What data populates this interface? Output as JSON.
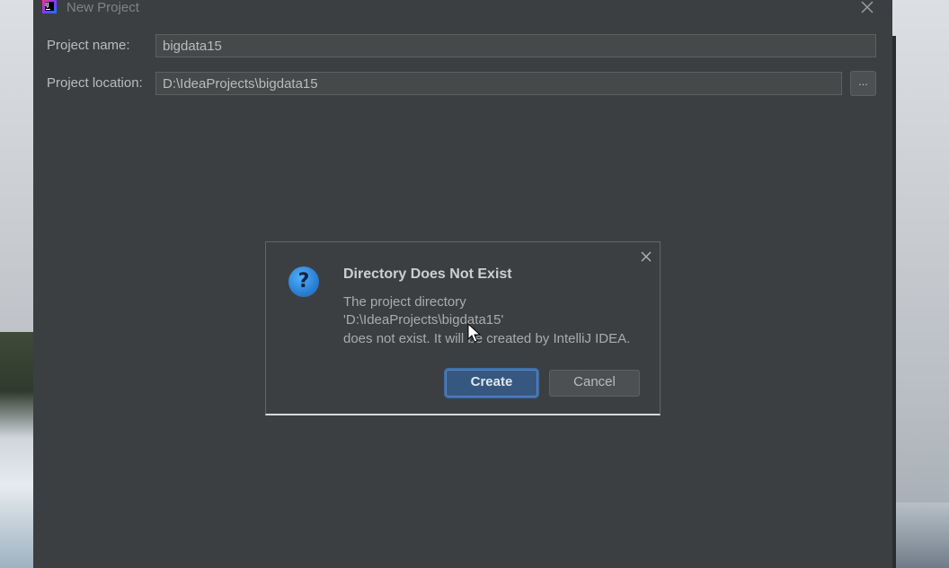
{
  "window": {
    "title": "New Project",
    "app_icon": "intellij-idea-icon",
    "close_icon": "close-icon"
  },
  "form": {
    "project_name_label": "Project name:",
    "project_name_value": "bigdata15",
    "project_location_label": "Project location:",
    "project_location_value": "D:\\IdeaProjects\\bigdata15",
    "browse_label": "..."
  },
  "dialog": {
    "title": "Directory Does Not Exist",
    "icon": "question-icon",
    "message_line1": "The project directory",
    "message_line2": "'D:\\IdeaProjects\\bigdata15'",
    "message_line3": "does not exist. It will be created by IntelliJ IDEA.",
    "create_label": "Create",
    "cancel_label": "Cancel"
  },
  "colors": {
    "window_bg": "#3c3f41",
    "primary_button": "#365880",
    "text": "#bbbbbb"
  }
}
